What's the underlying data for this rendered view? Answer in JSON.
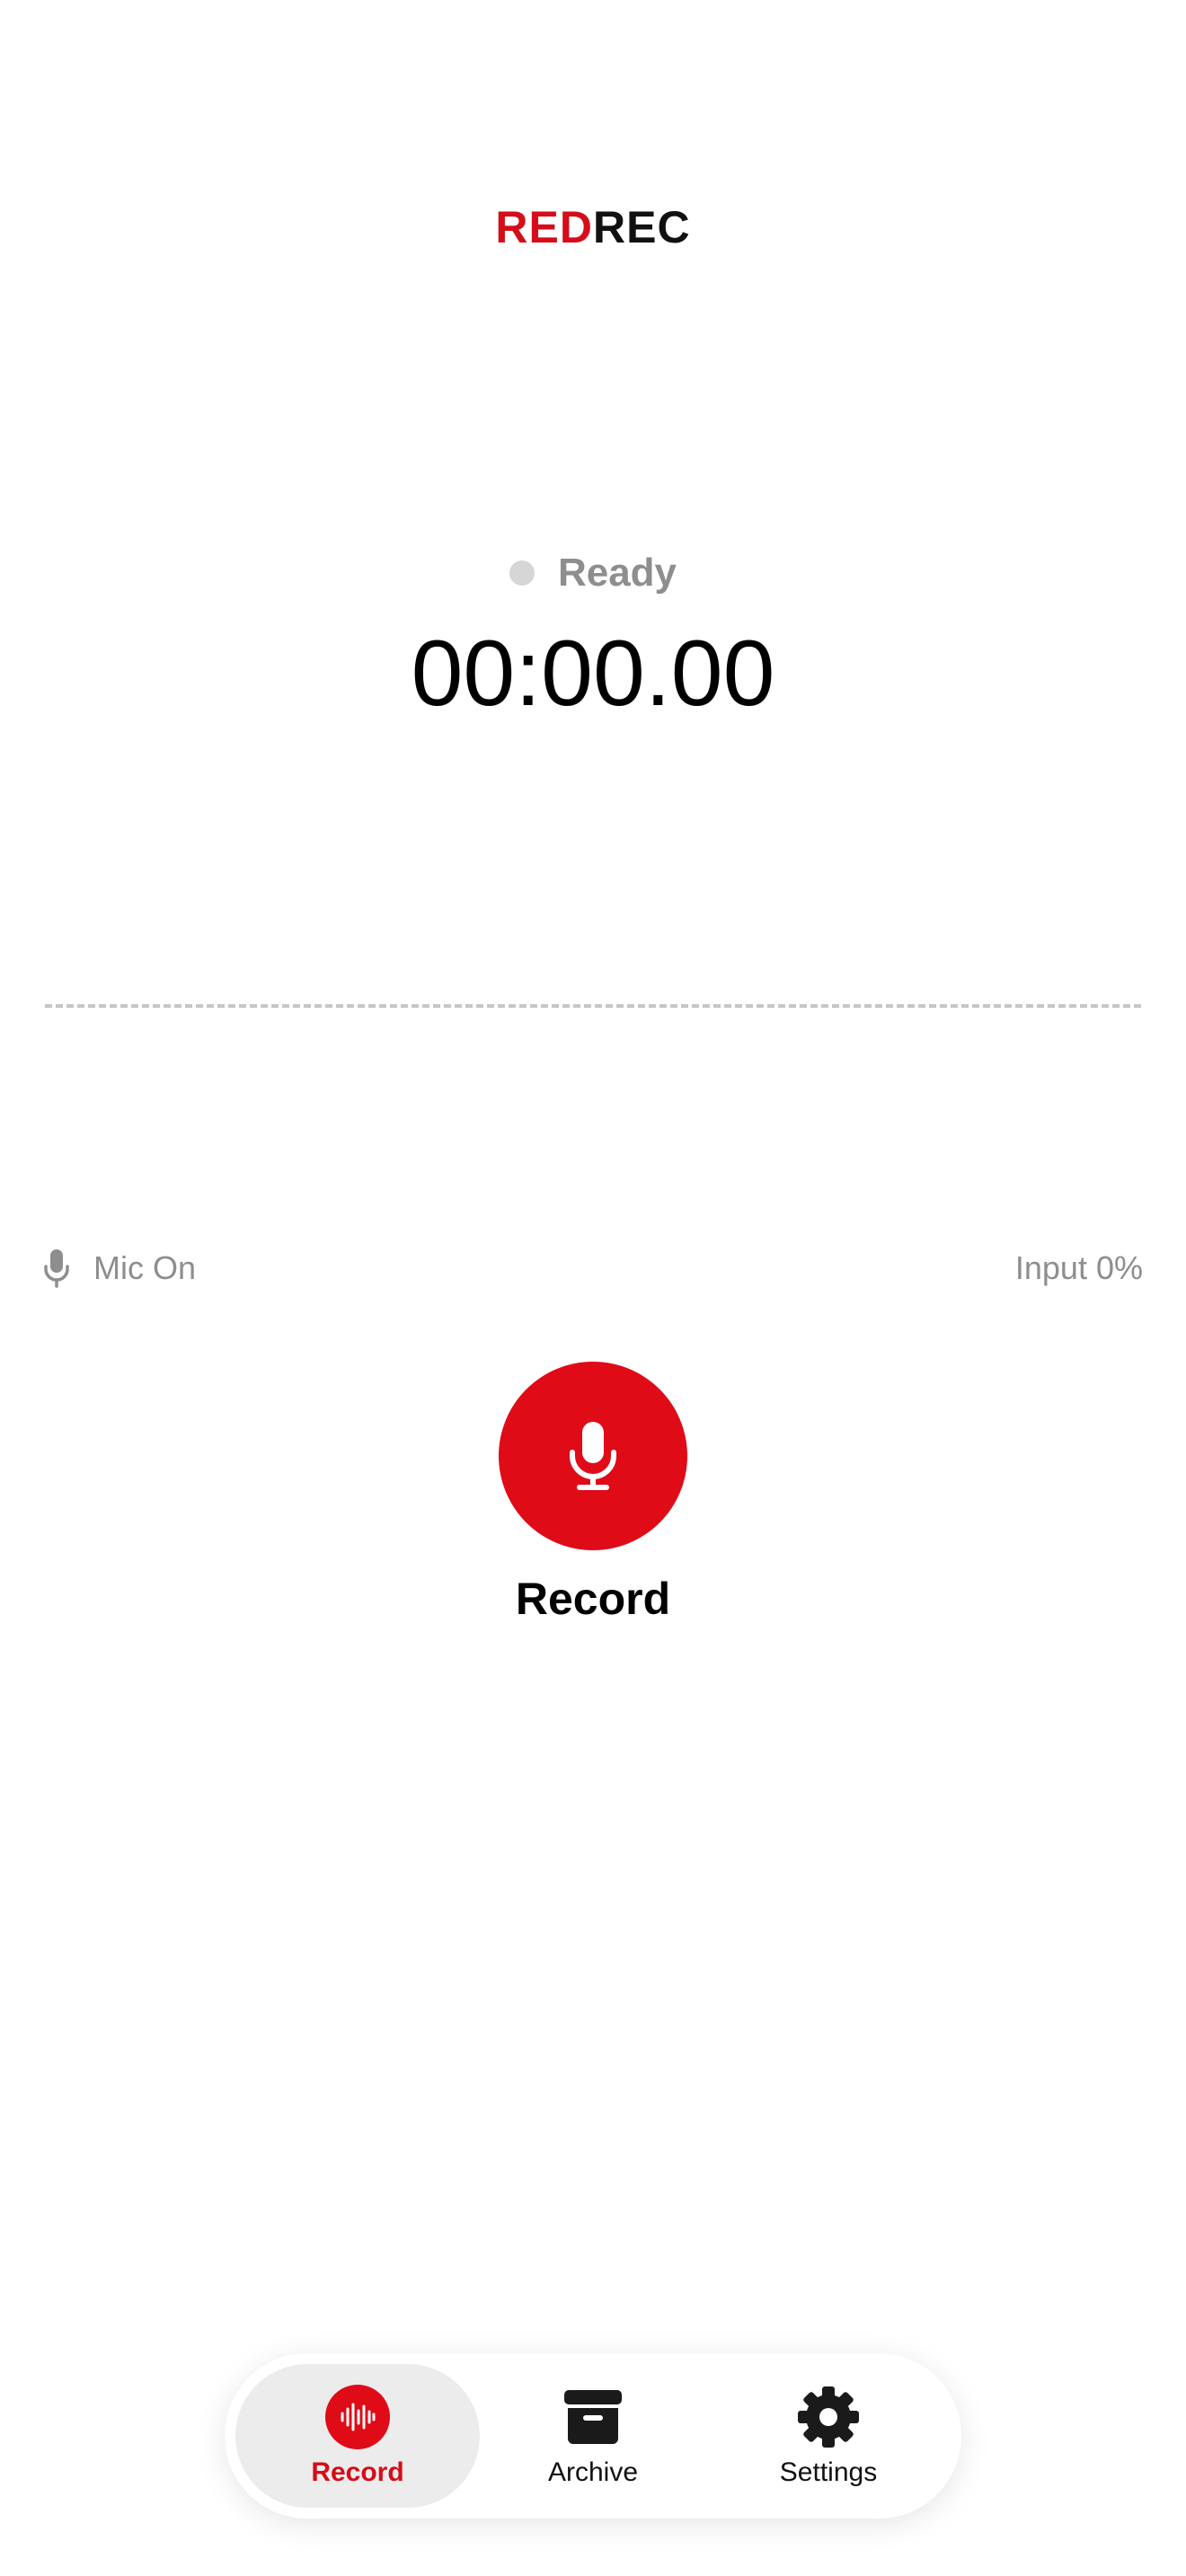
{
  "app": {
    "logo_part1": "RED",
    "logo_part2": "REC"
  },
  "status": {
    "label": "Ready",
    "timer": "00:00.00"
  },
  "input_row": {
    "mic_label": "Mic On",
    "input_level_label": "Input 0%",
    "input_level": 0
  },
  "record": {
    "label": "Record"
  },
  "tabbar": {
    "items": [
      {
        "label": "Record",
        "icon": "waveform-icon",
        "active": true
      },
      {
        "label": "Archive",
        "icon": "archive-box-icon",
        "active": false
      },
      {
        "label": "Settings",
        "icon": "gear-icon",
        "active": false
      }
    ]
  },
  "colors": {
    "accent": "#df0b17",
    "logo_red": "#d40d19",
    "muted_text": "#8e8e8e",
    "status_dot": "#d6d6d6"
  }
}
